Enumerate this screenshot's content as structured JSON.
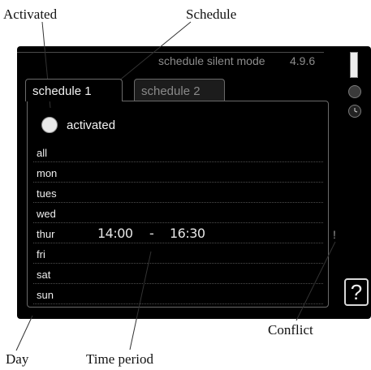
{
  "callouts": {
    "activated": "Activated",
    "schedule": "Schedule",
    "conflict": "Conflict",
    "day": "Day",
    "time_period": "Time period"
  },
  "header": {
    "title": "schedule silent mode",
    "code": "4.9.6"
  },
  "tabs": [
    {
      "label": "schedule 1",
      "active": true
    },
    {
      "label": "schedule 2",
      "active": false
    }
  ],
  "activated": {
    "label": "activated"
  },
  "days": [
    {
      "label": "all"
    },
    {
      "label": "mon"
    },
    {
      "label": "tues"
    },
    {
      "label": "wed"
    },
    {
      "label": "thur",
      "start": "14:00",
      "separator": "-",
      "end": "16:30"
    },
    {
      "label": "fri"
    },
    {
      "label": "sat"
    },
    {
      "label": "sun"
    }
  ],
  "conflict_mark": "!",
  "help": "?",
  "icons": {
    "scrollbar": "scrollbar-icon",
    "side_top": "info-icon",
    "side_bottom": "clock-icon"
  }
}
